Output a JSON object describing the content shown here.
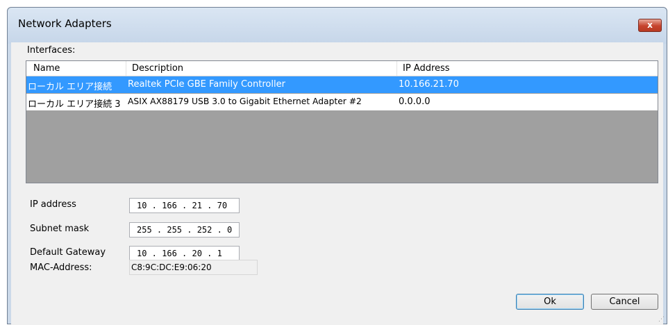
{
  "window": {
    "title": "Network Adapters",
    "close_label": "x"
  },
  "interfaces": {
    "label": "Interfaces:",
    "columns": [
      "Name",
      "Description",
      "IP Address"
    ],
    "rows": [
      {
        "name": "ローカル エリア接続",
        "description": "Realtek PCIe GBE Family Controller",
        "ip": "10.166.21.70",
        "selected": true
      },
      {
        "name": "ローカル エリア接続 3",
        "description": "ASIX AX88179 USB 3.0 to Gigabit Ethernet Adapter #2",
        "ip": "0.0.0.0",
        "selected": false
      }
    ]
  },
  "fields": {
    "ip_address": {
      "label": "IP address",
      "value": "10 . 166 . 21 . 70"
    },
    "subnet_mask": {
      "label": "Subnet mask",
      "value": "255 . 255 . 252 . 0"
    },
    "default_gateway": {
      "label": "Default Gateway",
      "value": "10 . 166 . 20 . 1"
    },
    "mac_address": {
      "label": "MAC-Address:",
      "value": "C8:9C:DC:E9:06:20"
    }
  },
  "buttons": {
    "ok": "Ok",
    "cancel": "Cancel"
  },
  "colors": {
    "selection": "#3399ff",
    "list_background": "#a0a0a0",
    "titlebar": "#cbd9e9"
  }
}
